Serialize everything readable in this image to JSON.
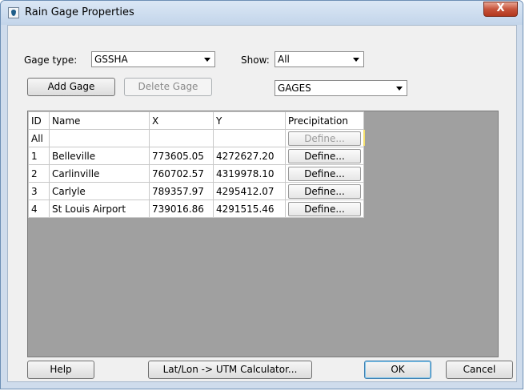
{
  "window": {
    "title": "Rain Gage Properties",
    "close_label": "X"
  },
  "controls": {
    "gage_type_label": "Gage type:",
    "gage_type_value": "GSSHA",
    "show_label": "Show:",
    "show_value": "All",
    "coverage_value": "GAGES",
    "add_gage_label": "Add Gage",
    "delete_gage_label": "Delete Gage"
  },
  "table": {
    "headers": [
      "ID",
      "Name",
      "X",
      "Y",
      "Precipitation"
    ],
    "all_row": {
      "id": "All",
      "name": "",
      "x": "",
      "y": "",
      "precip": "Define..."
    },
    "rows": [
      {
        "id": "1",
        "name": "Belleville",
        "x": "773605.05",
        "y": "4272627.20",
        "precip": "Define..."
      },
      {
        "id": "2",
        "name": "Carlinville",
        "x": "760702.57",
        "y": "4319978.10",
        "precip": "Define..."
      },
      {
        "id": "3",
        "name": "Carlyle",
        "x": "789357.97",
        "y": "4295412.07",
        "precip": "Define..."
      },
      {
        "id": "4",
        "name": "St Louis Airport",
        "x": "739016.86",
        "y": "4291515.46",
        "precip": "Define..."
      }
    ]
  },
  "footer": {
    "help_label": "Help",
    "calculator_label": "Lat/Lon -> UTM Calculator...",
    "ok_label": "OK",
    "cancel_label": "Cancel"
  },
  "colors": {
    "title_bar": "#c3d5ea",
    "close_button": "#c6533a",
    "grid_background": "#a0a0a0"
  }
}
